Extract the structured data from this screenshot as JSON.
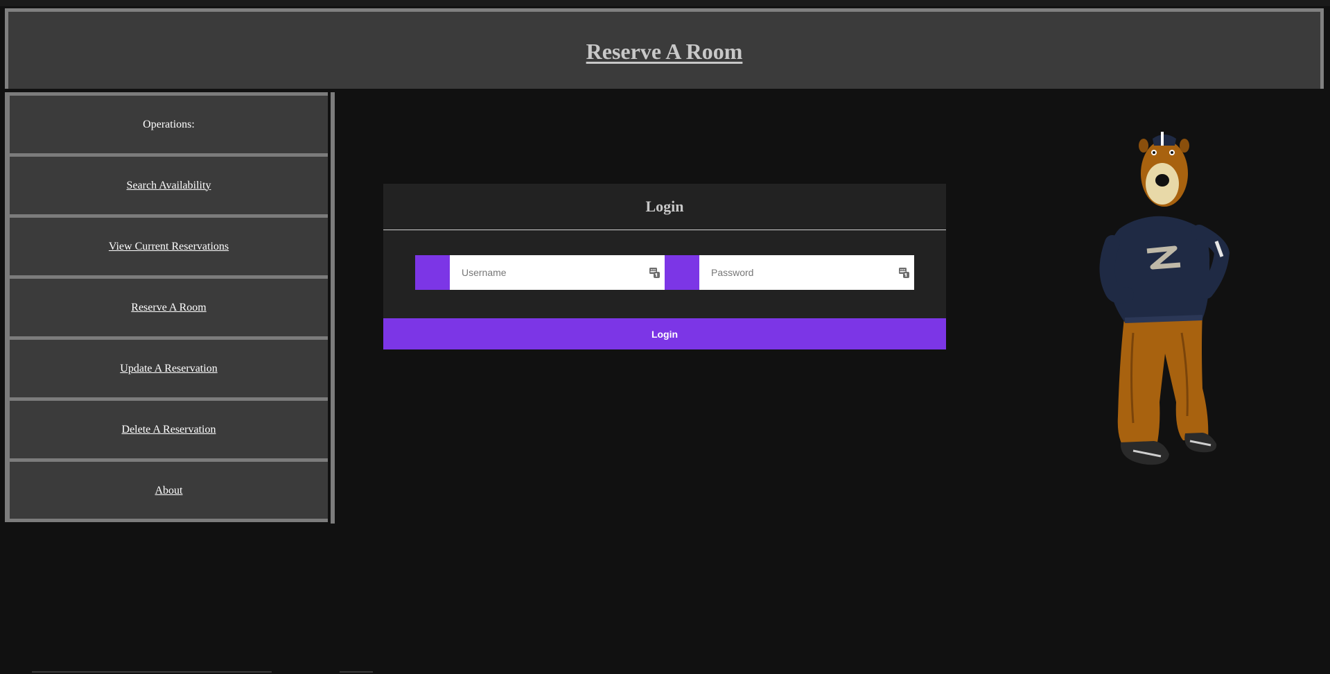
{
  "header": {
    "title": "Reserve A Room"
  },
  "sidebar": {
    "items": [
      {
        "label": "Operations:",
        "link": false
      },
      {
        "label": "Search Availability",
        "link": true
      },
      {
        "label": "View Current Reservations",
        "link": true
      },
      {
        "label": "Reserve A Room",
        "link": true
      },
      {
        "label": "Update A Reservation",
        "link": true
      },
      {
        "label": "Delete A Reservation",
        "link": true
      },
      {
        "label": "About",
        "link": true
      }
    ]
  },
  "login": {
    "title": "Login",
    "username": {
      "placeholder": "Username",
      "value": ""
    },
    "password": {
      "placeholder": "Password",
      "value": ""
    },
    "button_label": "Login"
  },
  "mascot": {
    "icon": "zippy-mascot-image"
  },
  "colors": {
    "accent": "#7c36e6",
    "background": "#111111",
    "panel": "#3b3b3b",
    "border": "#7c7c7c",
    "card": "#222222"
  }
}
